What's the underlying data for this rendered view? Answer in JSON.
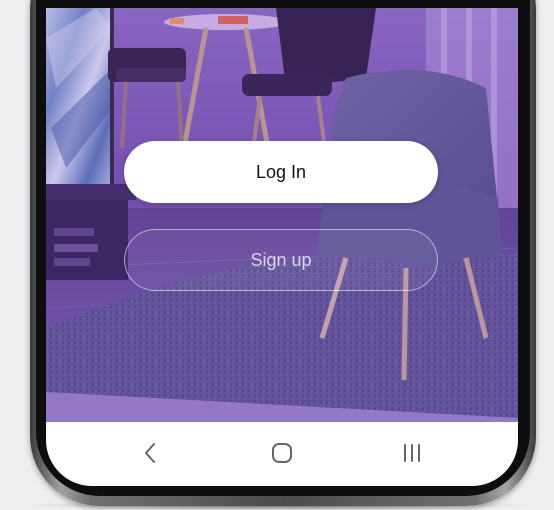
{
  "auth": {
    "login_label": "Log In",
    "signup_label": "Sign up"
  },
  "nav_bar": {
    "back_icon": "chevron-left",
    "home_icon": "rounded-square",
    "recents_icon": "three-vertical-lines"
  },
  "colors": {
    "background_tint": "#6a4d9e",
    "login_button_bg": "#ffffff",
    "login_text": "#111111",
    "signup_text": "#eee8fa",
    "nav_icon": "#666666"
  }
}
